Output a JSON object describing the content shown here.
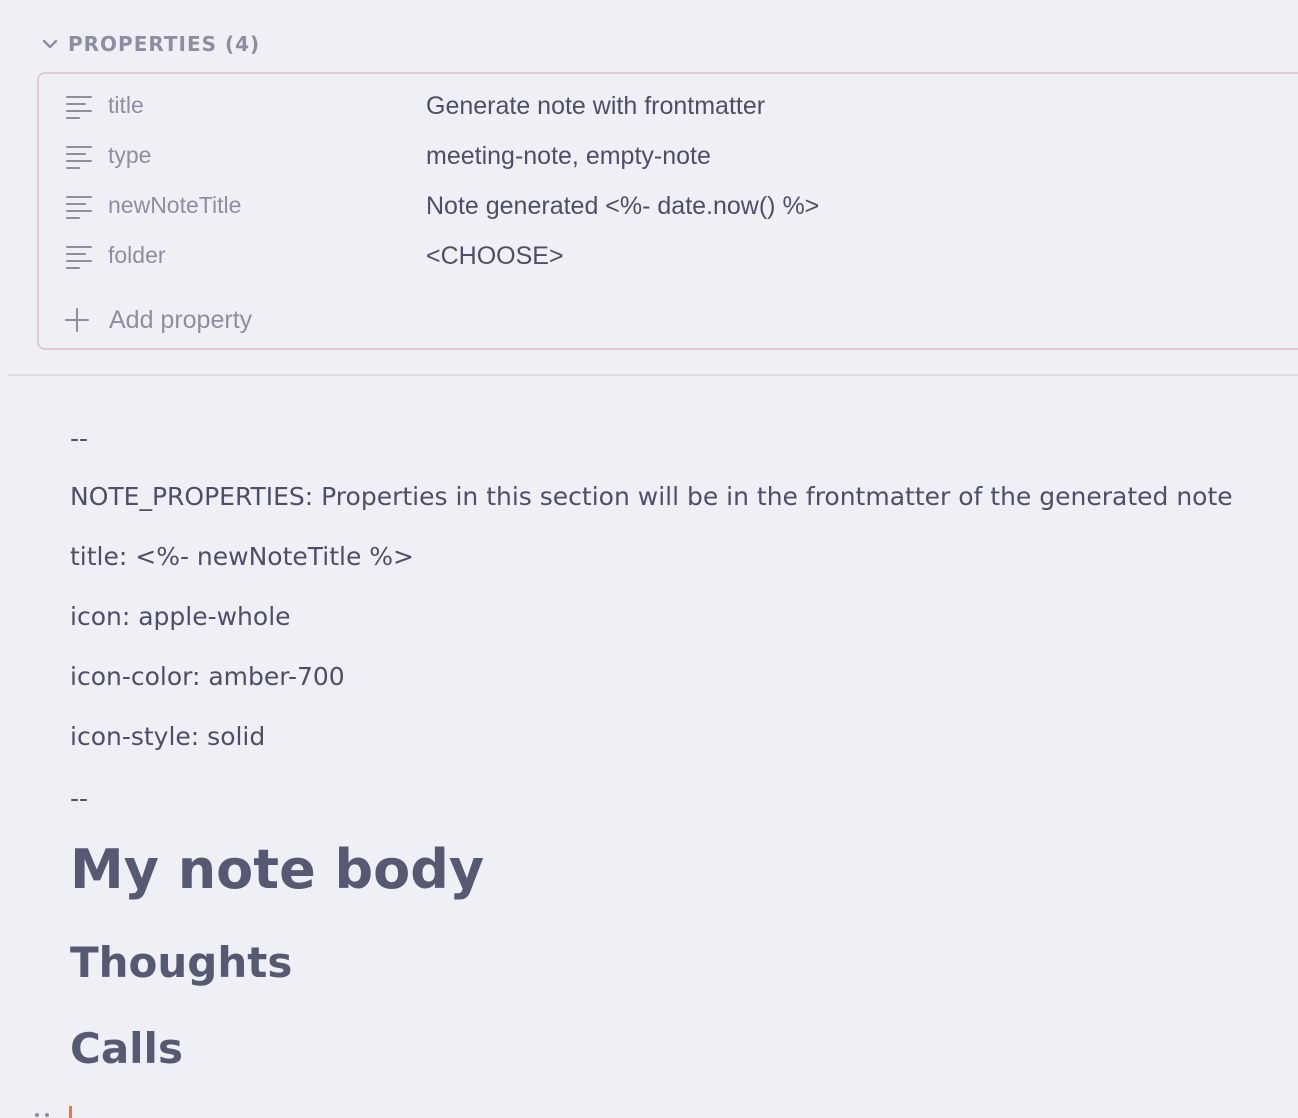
{
  "properties_section": {
    "header": "PROPERTIES (4)",
    "items": [
      {
        "key": "title",
        "value": "Generate note with frontmatter",
        "icon": "text-lines-icon"
      },
      {
        "key": "type",
        "value": "meeting-note, empty-note",
        "icon": "text-lines-icon"
      },
      {
        "key": "newNoteTitle",
        "value": "Note generated <%- date.now() %>",
        "icon": "text-lines-icon"
      },
      {
        "key": "folder",
        "value": "<CHOOSE>",
        "icon": "text-lines-icon"
      }
    ],
    "add_label": "Add property"
  },
  "note": {
    "lines": [
      "--",
      "NOTE_PROPERTIES: Properties in this section will be in the frontmatter of the generated note",
      "title: <%- newNoteTitle %>",
      "icon: apple-whole",
      "icon-color: amber-700",
      "icon-style: solid",
      "--"
    ],
    "heading1": "My note body",
    "heading2a": "Thoughts",
    "heading2b": "Calls"
  },
  "colors": {
    "background": "#eff0f5",
    "properties_border": "#e8c8d0",
    "text": "#4c4f69",
    "muted_text": "#8c8fa1",
    "cursor": "#e0785a"
  }
}
